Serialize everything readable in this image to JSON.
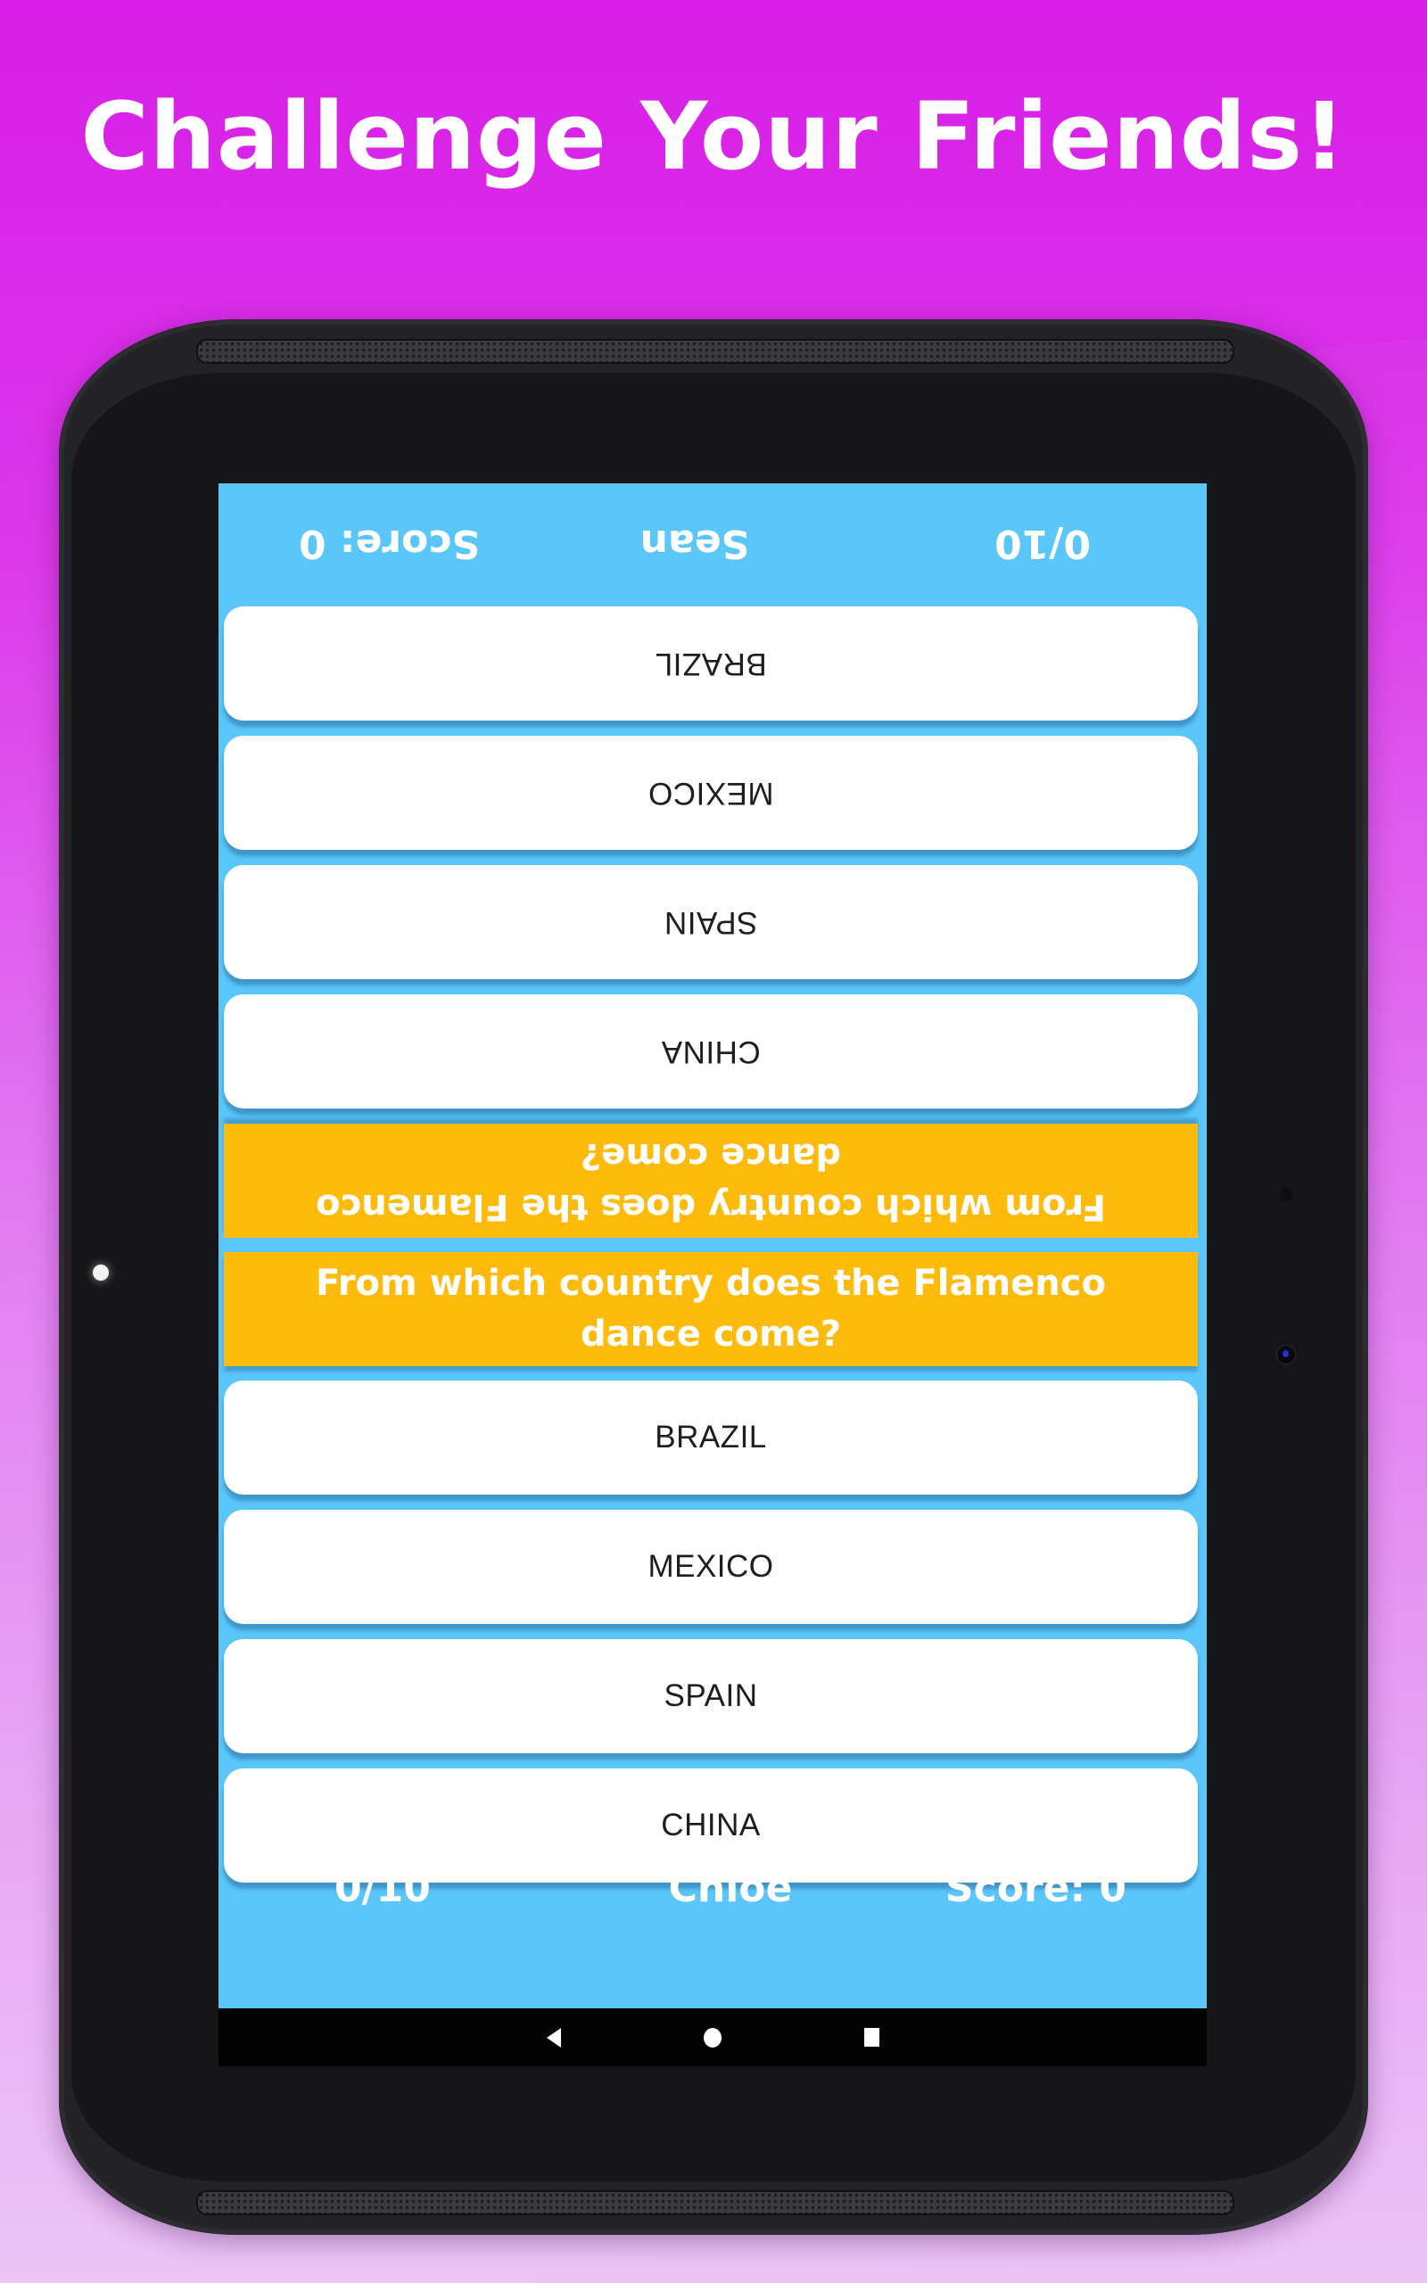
{
  "headline": "Challenge Your Friends!",
  "colors": {
    "background_top": "#d81ee8",
    "background_bottom": "#ebc4f6",
    "screen_blue": "#5bc6fa",
    "question_yellow": "#ffbb0b",
    "answer_white": "#ffffff",
    "answer_text": "#1e1e1e"
  },
  "top_player": {
    "progress": "0/10",
    "name": "Sean",
    "score": "Score: 0",
    "orientation": "upside-down"
  },
  "bottom_player": {
    "progress": "0/10",
    "name": "Chloe",
    "score": "Score: 0"
  },
  "question": "From which country does the Flamenco dance come?",
  "top_answers": [
    {
      "label": "BRAZIL"
    },
    {
      "label": "MEXICO"
    },
    {
      "label": "SPAIN"
    },
    {
      "label": "CHINA"
    }
  ],
  "bottom_answers": [
    {
      "label": "BRAZIL"
    },
    {
      "label": "MEXICO"
    },
    {
      "label": "SPAIN"
    },
    {
      "label": "CHINA"
    }
  ],
  "navbar": {
    "back_icon": "back-triangle-icon",
    "home_icon": "home-circle-icon",
    "recents_icon": "recents-square-icon"
  }
}
